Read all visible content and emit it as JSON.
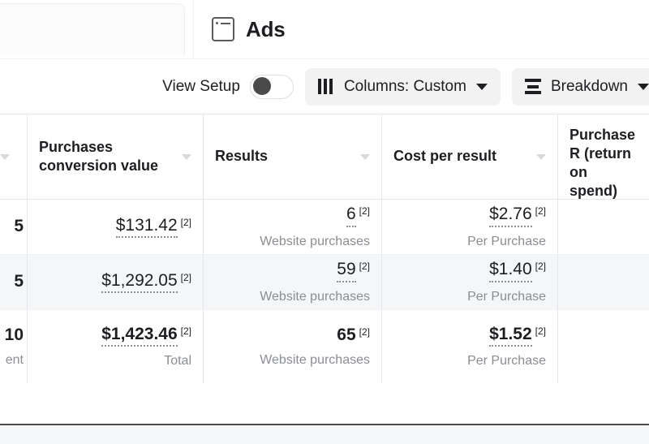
{
  "tabs": {
    "inactive_tab_label": "",
    "active_tab": {
      "label": "Ads",
      "icon": "ads-card-icon"
    }
  },
  "toolbar": {
    "view_setup_label": "View Setup",
    "view_setup_toggle_state": "off",
    "columns_button": {
      "label": "Columns: Custom",
      "icon": "columns-icon",
      "caret": "chevron-down-icon"
    },
    "breakdown_button": {
      "label": "Breakdown",
      "icon": "breakdown-icon",
      "caret": "chevron-down-icon"
    }
  },
  "table": {
    "headers": [
      {
        "label": "",
        "sort": "sort-caret"
      },
      {
        "label": "Purchases conversion value",
        "sort": "sort-caret"
      },
      {
        "label": "Results",
        "sort": "sort-caret"
      },
      {
        "label": "Cost per result",
        "sort": "sort-caret"
      },
      {
        "label": "Purchase R (return on spend)",
        "sort": ""
      }
    ],
    "rows": [
      {
        "clipped_value": "5",
        "clipped_sub": "",
        "purchases_conversion_value": "$131.42",
        "purchases_conversion_value_note": "[2]",
        "purchases_conversion_value_sub": "",
        "results": "6",
        "results_note": "[2]",
        "results_sub": "Website purchases",
        "cost_per_result": "$2.76",
        "cost_per_result_note": "[2]",
        "cost_per_result_sub": "Per Purchase",
        "purchase_roas": ""
      },
      {
        "clipped_value": "5",
        "clipped_sub": "",
        "purchases_conversion_value": "$1,292.05",
        "purchases_conversion_value_note": "[2]",
        "purchases_conversion_value_sub": "",
        "results": "59",
        "results_note": "[2]",
        "results_sub": "Website purchases",
        "cost_per_result": "$1.40",
        "cost_per_result_note": "[2]",
        "cost_per_result_sub": "Per Purchase",
        "purchase_roas": ""
      },
      {
        "clipped_value": "10",
        "clipped_sub": "ent",
        "purchases_conversion_value": "$1,423.46",
        "purchases_conversion_value_note": "[2]",
        "purchases_conversion_value_sub": "Total",
        "results": "65",
        "results_note": "[2]",
        "results_sub": "Website purchases",
        "cost_per_result": "$1.52",
        "cost_per_result_note": "[2]",
        "cost_per_result_sub": "Per Purchase",
        "purchase_roas": ""
      }
    ]
  },
  "colors": {
    "text_primary": "#1c1e21",
    "text_muted": "#8a8d91",
    "row_stripe": "#f5f6f7",
    "border": "#e4e6eb",
    "pill_bg": "#f2f2f2"
  }
}
